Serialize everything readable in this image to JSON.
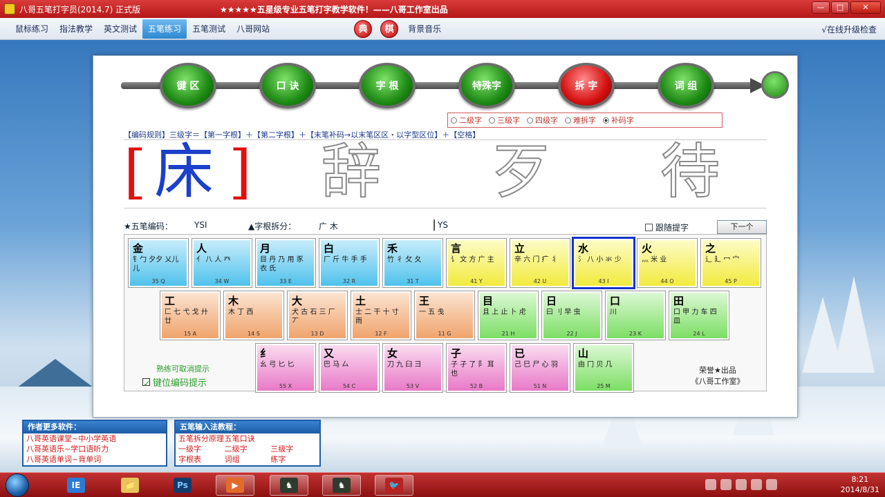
{
  "window": {
    "title": "八哥五笔打字员(2014.7) 正式版",
    "slogan": "★★★★★五星级专业五笔打字教学软件！——八哥工作室出品",
    "buttons": {
      "minimize": "—",
      "maximize": "□",
      "close": "✕"
    }
  },
  "menu": {
    "items": [
      {
        "label": "鼠标练习",
        "active": false
      },
      {
        "label": "指法教学",
        "active": false
      },
      {
        "label": "英文测试",
        "active": false
      },
      {
        "label": "五笔练习",
        "active": true
      },
      {
        "label": "五笔测试",
        "active": false
      },
      {
        "label": "八哥网站",
        "active": false
      }
    ],
    "badge_dian": "典",
    "badge_qi": "棋",
    "music": "背景音乐",
    "upgrade": "√在线升级检查"
  },
  "steps": [
    {
      "label": "键 区",
      "active": false
    },
    {
      "label": "口 诀",
      "active": false
    },
    {
      "label": "字 根",
      "active": false
    },
    {
      "label": "特殊字",
      "active": false
    },
    {
      "label": "拆 字",
      "active": true
    },
    {
      "label": "词 组",
      "active": false
    }
  ],
  "radio": {
    "options": [
      "二级字",
      "三级字",
      "四级字",
      "难拆字",
      "补码字"
    ],
    "selected": "补码字"
  },
  "rule": "【编码规则】三级字＝【第一字根】＋【第二字根】＋【末笔补码→以末笔区区・以字型区位】＋【空格】",
  "characters": {
    "current": "床",
    "upcoming": [
      "辞",
      "歹",
      "待"
    ]
  },
  "info": {
    "code_label": "★五笔编码：",
    "code_value": "YSI",
    "split_label": "▲字根拆分：",
    "split_value": "广 木",
    "typed": "YS",
    "follow_label": "跟随提字",
    "next_label": "下一个"
  },
  "keyboard": {
    "row1": [
      {
        "root": "金",
        "roots": "钅勹 夕夕 乂儿 儿",
        "code": "35 Q",
        "color": "blue",
        "selected": false
      },
      {
        "root": "人",
        "roots": "亻 八 人 癶",
        "code": "34 W",
        "color": "blue",
        "selected": false
      },
      {
        "root": "月",
        "roots": "目 丹 乃 用 豕 衣 氏",
        "code": "33 E",
        "color": "blue",
        "selected": false
      },
      {
        "root": "白",
        "roots": "厂 斤 牛 手 手",
        "code": "32 R",
        "color": "blue",
        "selected": false
      },
      {
        "root": "禾",
        "roots": "竹 彳 攵 夂",
        "code": "31 T",
        "color": "blue",
        "selected": false
      },
      {
        "root": "言",
        "roots": "讠 文 方 广 主",
        "code": "41 Y",
        "color": "yellow",
        "selected": false
      },
      {
        "root": "立",
        "roots": "辛 六 门 疒 丬",
        "code": "42 U",
        "color": "yellow",
        "selected": false
      },
      {
        "root": "水",
        "roots": "氵 八 小 氺 少",
        "code": "43 I",
        "color": "yellow",
        "selected": true
      },
      {
        "root": "火",
        "roots": "灬 米 业",
        "code": "44 O",
        "color": "yellow",
        "selected": false
      },
      {
        "root": "之",
        "roots": "辶 廴 冖 宀",
        "code": "45 P",
        "color": "yellow",
        "selected": false
      }
    ],
    "row2": [
      {
        "root": "工",
        "roots": "匚 七 弋 戈 廾 廿",
        "code": "15 A",
        "color": "orange",
        "selected": false
      },
      {
        "root": "木",
        "roots": "木 丁 西",
        "code": "14 S",
        "color": "orange",
        "selected": false
      },
      {
        "root": "大",
        "roots": "犬 古 石 三 厂 丆",
        "code": "13 D",
        "color": "orange",
        "selected": false
      },
      {
        "root": "土",
        "roots": "士 二 干 十 寸 雨",
        "code": "12 F",
        "color": "orange",
        "selected": false
      },
      {
        "root": "王",
        "roots": "一 五 戋",
        "code": "11 G",
        "color": "orange",
        "selected": false
      },
      {
        "root": "目",
        "roots": "且 上 止 卜 虍",
        "code": "21 H",
        "color": "green",
        "selected": false
      },
      {
        "root": "日",
        "roots": "曰 刂 早 虫",
        "code": "22 J",
        "color": "green",
        "selected": false
      },
      {
        "root": "口",
        "roots": "川",
        "code": "23 K",
        "color": "green",
        "selected": false
      },
      {
        "root": "田",
        "roots": "口 甲 力 车 四 皿",
        "code": "24 L",
        "color": "green",
        "selected": false
      }
    ],
    "row3": [
      {
        "root": "纟",
        "roots": "幺 弓 匕 匕",
        "code": "55 X",
        "color": "pink",
        "selected": false
      },
      {
        "root": "又",
        "roots": "巴 马 厶",
        "code": "54 C",
        "color": "pink",
        "selected": false
      },
      {
        "root": "女",
        "roots": "刀 九 臼 彐",
        "code": "53 V",
        "color": "pink",
        "selected": false
      },
      {
        "root": "子",
        "roots": "子 孑 了 阝 耳 也",
        "code": "52 B",
        "color": "pink",
        "selected": false
      },
      {
        "root": "已",
        "roots": "己 巳 尸 心 羽",
        "code": "51 N",
        "color": "pink",
        "selected": false
      },
      {
        "root": "山",
        "roots": "由 冂 贝 几",
        "code": "25 M",
        "color": "green",
        "selected": false
      }
    ],
    "hint": "熟练可取消提示",
    "checkbox_label": "键位编码提示",
    "credit_line1": "荣誉★出品",
    "credit_line2": "《八哥工作室》"
  },
  "bottom": {
    "box1_title": "作者更多软件：",
    "box1_lines": [
      "八哥英语课堂~中小学英语",
      "八哥英语乐~学口语听力",
      "八哥英语单词~背单词"
    ],
    "box2_title": "五笔输入法教程：",
    "box2_items": [
      "五笔拆分原理",
      "五笔口诀",
      "",
      "一级字",
      "二级字",
      "三级字",
      "字根表",
      "词组",
      "练字"
    ]
  },
  "taskbar": {
    "apps": [
      "IE",
      "📁",
      "Ps",
      "▶",
      "♞",
      "♞",
      "🐦"
    ],
    "time": "8:21",
    "date": "2014/8/31"
  }
}
